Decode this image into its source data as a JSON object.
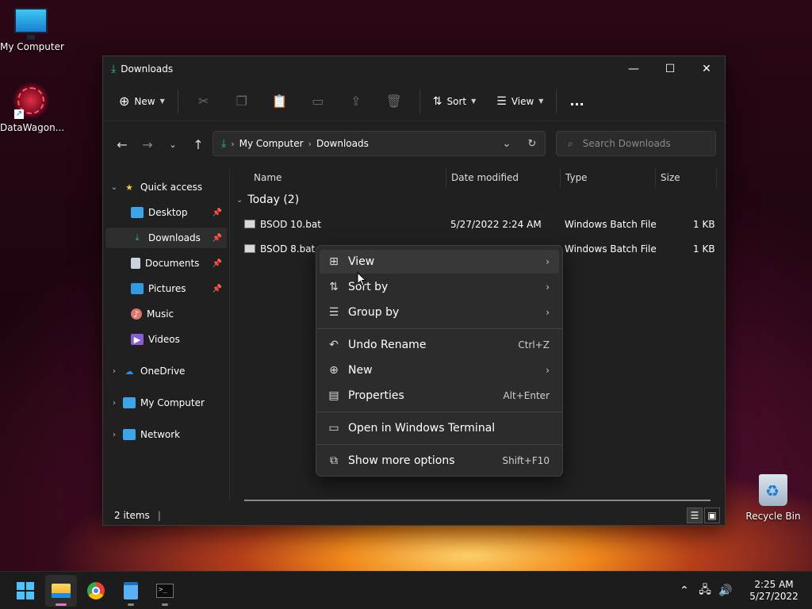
{
  "desktop": {
    "icons": [
      {
        "label": "My Computer"
      },
      {
        "label": "DataWagon..."
      },
      {
        "label": "Recycle Bin"
      }
    ]
  },
  "window": {
    "title": "Downloads",
    "toolbar": {
      "new_label": "New",
      "sort_label": "Sort",
      "view_label": "View",
      "more_label": "..."
    },
    "address": {
      "segments": [
        "My Computer",
        "Downloads"
      ]
    },
    "search": {
      "placeholder": "Search Downloads"
    },
    "sidebar": {
      "quick_access": "Quick access",
      "items": [
        {
          "label": "Desktop",
          "icon": "desktop-icon",
          "pinned": true
        },
        {
          "label": "Downloads",
          "icon": "download-icon",
          "pinned": true,
          "selected": true
        },
        {
          "label": "Documents",
          "icon": "document-icon",
          "pinned": true
        },
        {
          "label": "Pictures",
          "icon": "pictures-icon",
          "pinned": true
        },
        {
          "label": "Music",
          "icon": "music-icon",
          "pinned": false
        },
        {
          "label": "Videos",
          "icon": "videos-icon",
          "pinned": false
        }
      ],
      "onedrive": "OneDrive",
      "my_computer": "My Computer",
      "network": "Network"
    },
    "columns": {
      "name": "Name",
      "date": "Date modified",
      "type": "Type",
      "size": "Size"
    },
    "group": {
      "label": "Today (2)"
    },
    "files": [
      {
        "name": "BSOD 10.bat",
        "date": "5/27/2022 2:24 AM",
        "type": "Windows Batch File",
        "size": "1 KB"
      },
      {
        "name": "BSOD 8.bat",
        "date": "",
        "type": "Windows Batch File",
        "size": "1 KB"
      }
    ],
    "status": {
      "items": "2 items",
      "cursor": "|"
    }
  },
  "context_menu": {
    "items": [
      {
        "label": "View",
        "icon": "grid-icon",
        "submenu": true,
        "shortcut": ""
      },
      {
        "label": "Sort by",
        "icon": "sort-icon",
        "submenu": true,
        "shortcut": ""
      },
      {
        "label": "Group by",
        "icon": "group-icon",
        "submenu": true,
        "shortcut": ""
      },
      {
        "label": "Undo Rename",
        "icon": "undo-icon",
        "submenu": false,
        "shortcut": "Ctrl+Z"
      },
      {
        "label": "New",
        "icon": "plus-icon",
        "submenu": true,
        "shortcut": ""
      },
      {
        "label": "Properties",
        "icon": "properties-icon",
        "submenu": false,
        "shortcut": "Alt+Enter"
      },
      {
        "label": "Open in Windows Terminal",
        "icon": "terminal-icon",
        "submenu": false,
        "shortcut": ""
      },
      {
        "label": "Show more options",
        "icon": "more-options-icon",
        "submenu": false,
        "shortcut": "Shift+F10"
      }
    ]
  },
  "taskbar": {
    "clock": {
      "time": "2:25 AM",
      "date": "5/27/2022"
    }
  },
  "colors": {
    "accent": "#4cc2ff",
    "window_bg": "#202020",
    "menu_bg": "#2c2c2c"
  }
}
